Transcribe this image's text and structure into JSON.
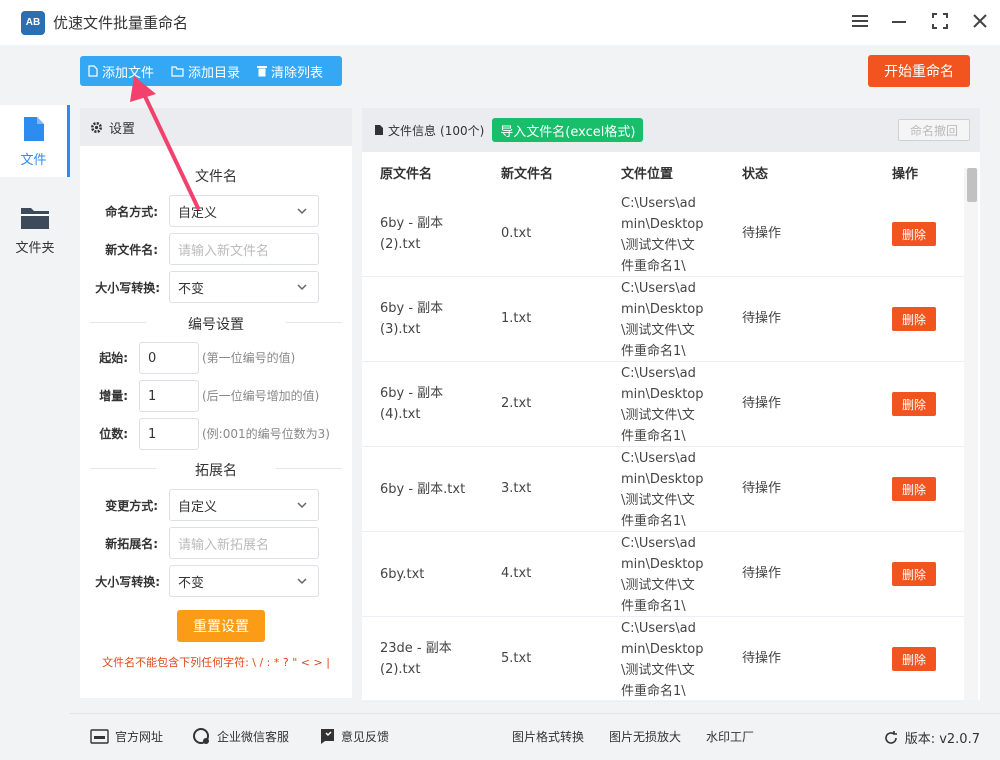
{
  "app": {
    "title": "优速文件批量重命名"
  },
  "nav": {
    "items": [
      {
        "label": "文件"
      },
      {
        "label": "文件夹"
      }
    ]
  },
  "toolbar": {
    "add_file": "添加文件",
    "add_dir": "添加目录",
    "clear_list": "清除列表",
    "start": "开始重命名"
  },
  "settings": {
    "header": "设置",
    "filename": {
      "title": "文件名",
      "naming_label": "命名方式:",
      "naming_value": "自定义",
      "newname_label": "新文件名:",
      "newname_placeholder": "请输入新文件名",
      "case_label": "大小写转换:",
      "case_value": "不变"
    },
    "numbering": {
      "title": "编号设置",
      "start_label": "起始:",
      "start_value": "0",
      "start_hint": "(第一位编号的值)",
      "step_label": "增量:",
      "step_value": "1",
      "step_hint": "(后一位编号增加的值)",
      "digits_label": "位数:",
      "digits_value": "1",
      "digits_hint": "(例:001的编号位数为3)"
    },
    "extension": {
      "title": "拓展名",
      "mode_label": "变更方式:",
      "mode_value": "自定义",
      "newext_label": "新拓展名:",
      "newext_placeholder": "请输入新拓展名",
      "case_label": "大小写转换:",
      "case_value": "不变"
    },
    "reset": "重置设置",
    "warning": "文件名不能包含下列任何字符: \\ / : * ? \" < > |"
  },
  "files": {
    "info_label": "文件信息",
    "count": "(100个)",
    "import_btn": "导入文件名(excel格式)",
    "undo_btn": "命名撤回",
    "columns": [
      "原文件名",
      "新文件名",
      "文件位置",
      "状态",
      "操作"
    ],
    "rows": [
      {
        "orig": [
          "6by - 副本",
          "(2).txt"
        ],
        "new": "0.txt",
        "path": [
          "C:\\Users\\ad",
          "min\\Desktop",
          "\\测试文件\\文",
          "件重命名1\\"
        ],
        "status": "待操作",
        "action": "删除"
      },
      {
        "orig": [
          "6by - 副本",
          "(3).txt"
        ],
        "new": "1.txt",
        "path": [
          "C:\\Users\\ad",
          "min\\Desktop",
          "\\测试文件\\文",
          "件重命名1\\"
        ],
        "status": "待操作",
        "action": "删除"
      },
      {
        "orig": [
          "6by - 副本",
          "(4).txt"
        ],
        "new": "2.txt",
        "path": [
          "C:\\Users\\ad",
          "min\\Desktop",
          "\\测试文件\\文",
          "件重命名1\\"
        ],
        "status": "待操作",
        "action": "删除"
      },
      {
        "orig": [
          "6by - 副本.txt"
        ],
        "new": "3.txt",
        "path": [
          "C:\\Users\\ad",
          "min\\Desktop",
          "\\测试文件\\文",
          "件重命名1\\"
        ],
        "status": "待操作",
        "action": "删除"
      },
      {
        "orig": [
          "6by.txt"
        ],
        "new": "4.txt",
        "path": [
          "C:\\Users\\ad",
          "min\\Desktop",
          "\\测试文件\\文",
          "件重命名1\\"
        ],
        "status": "待操作",
        "action": "删除"
      },
      {
        "orig": [
          "23de - 副本",
          "(2).txt"
        ],
        "new": "5.txt",
        "path": [
          "C:\\Users\\ad",
          "min\\Desktop",
          "\\测试文件\\文",
          "件重命名1\\"
        ],
        "status": "待操作",
        "action": "删除"
      }
    ]
  },
  "footer": {
    "website": "官方网址",
    "wechat": "企业微信客服",
    "feedback": "意见反馈",
    "img_convert": "图片格式转换",
    "img_enlarge": "图片无损放大",
    "watermark": "水印工厂",
    "version": "版本: v2.0.7"
  },
  "colors": {
    "accent": "#35a8f5",
    "nav_active": "#2d8cf0",
    "danger": "#f1541f",
    "success": "#19be6b",
    "warning": "#fa9c16",
    "annotation_arrow": "#f1416c"
  }
}
